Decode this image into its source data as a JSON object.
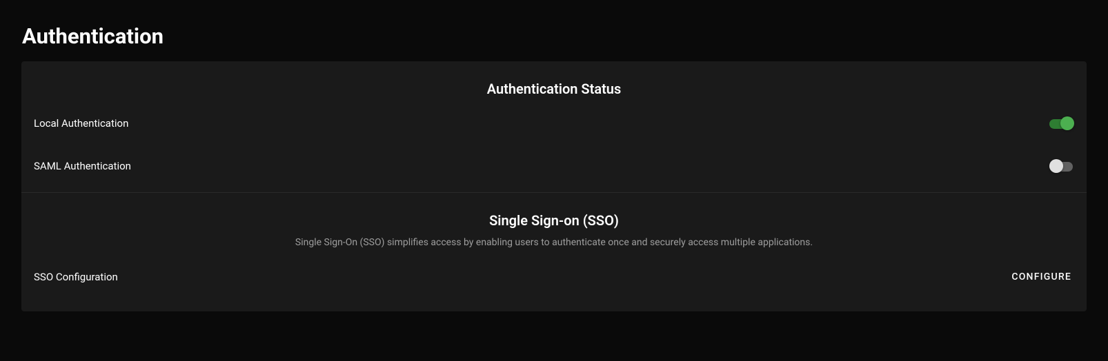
{
  "page": {
    "title": "Authentication"
  },
  "status": {
    "title": "Authentication Status",
    "items": [
      {
        "label": "Local Authentication",
        "enabled": true
      },
      {
        "label": "SAML Authentication",
        "enabled": false
      }
    ]
  },
  "sso": {
    "title": "Single Sign-on (SSO)",
    "description": "Single Sign-On (SSO) simplifies access by enabling users to authenticate once and securely access multiple applications.",
    "config_label": "SSO Configuration",
    "configure_button": "CONFIGURE"
  }
}
